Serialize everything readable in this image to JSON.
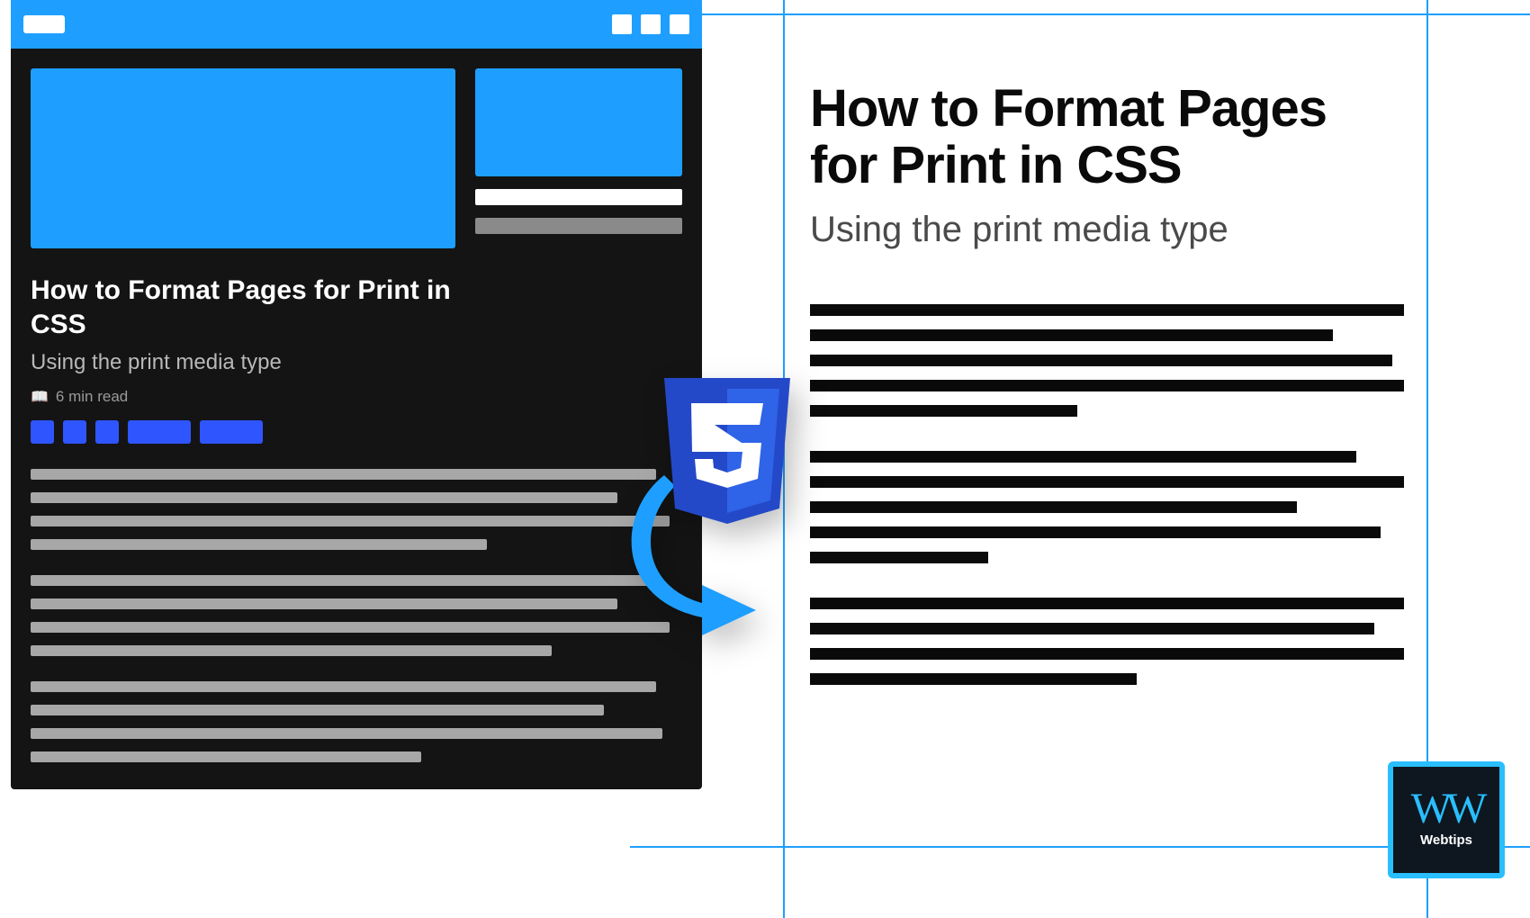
{
  "article": {
    "title": "How to Format Pages for Print in CSS",
    "subtitle": "Using the print media type",
    "readtime_label": "6 min read"
  },
  "print": {
    "title": "How to Format Pages for Print in CSS",
    "subtitle": "Using the print media type"
  },
  "brand": {
    "mark": "WW",
    "name": "Webtips"
  },
  "colors": {
    "accent_blue": "#1E9FFF",
    "tag_blue": "#2F55FF",
    "dark": "#141414",
    "logo_border": "#29BFFF"
  }
}
